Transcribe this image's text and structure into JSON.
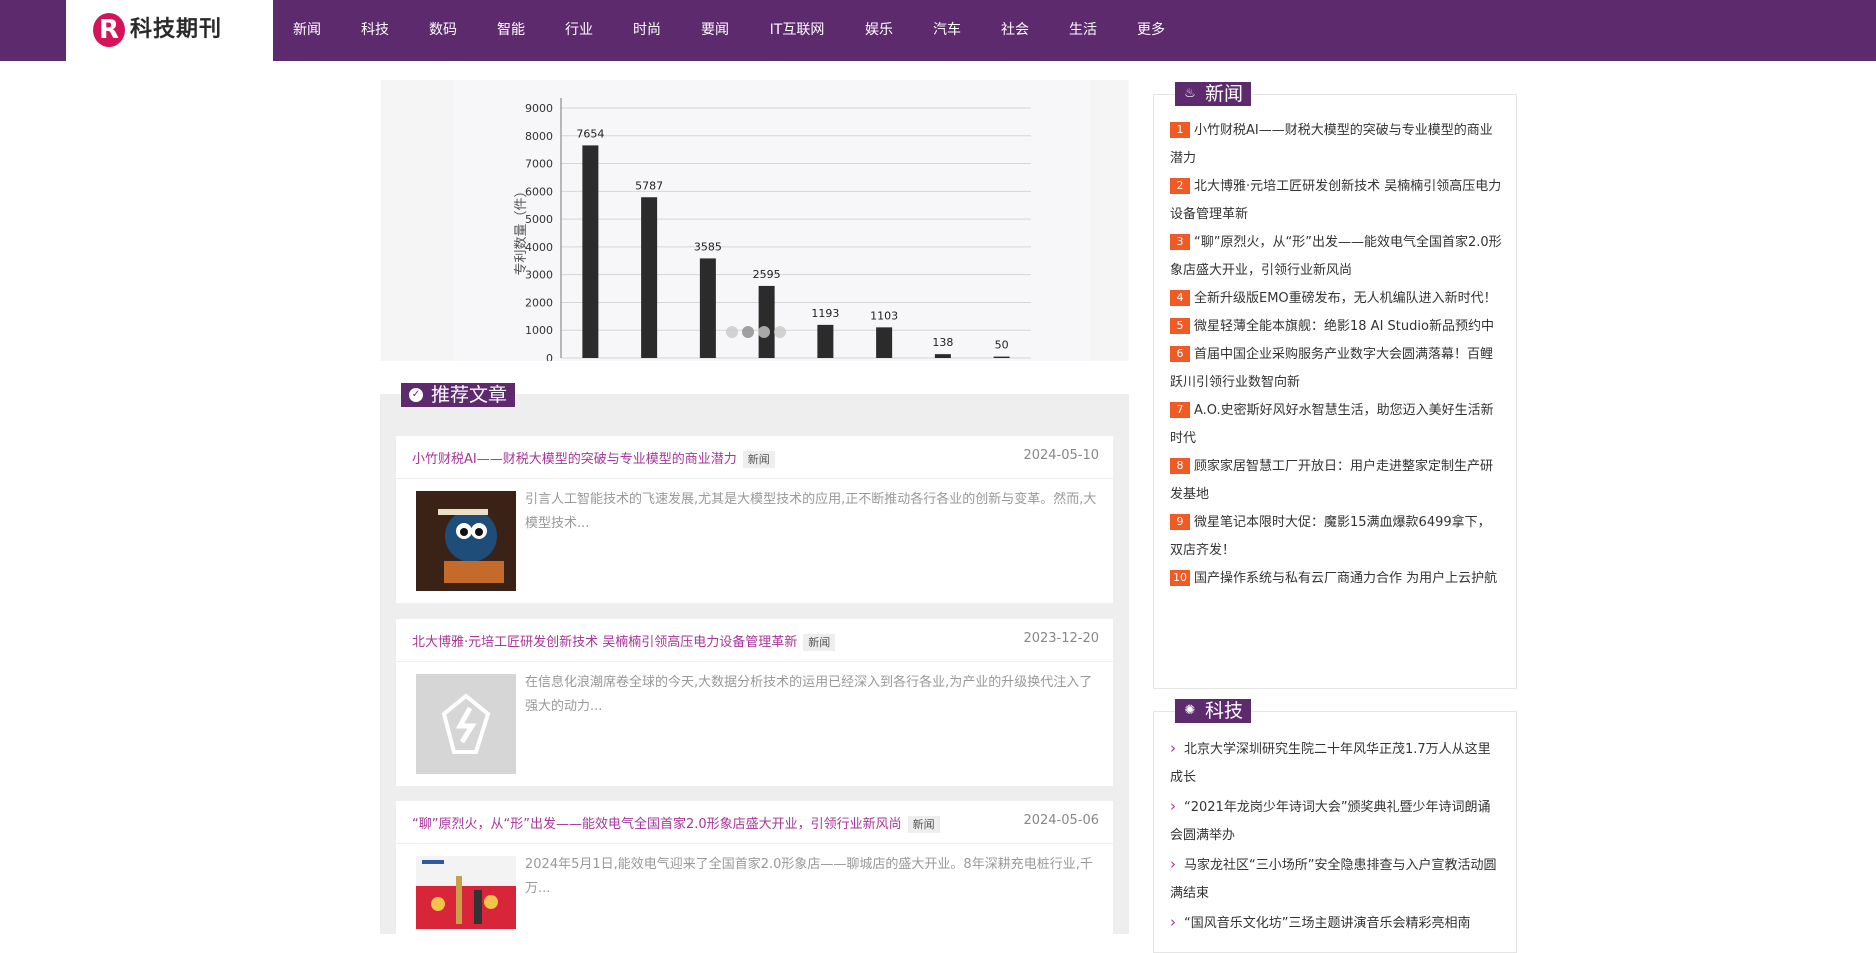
{
  "logo": {
    "text": "科技期刊",
    "mark": "R"
  },
  "nav": [
    "新闻",
    "科技",
    "数码",
    "智能",
    "行业",
    "时尚",
    "要闻",
    "IT互联网",
    "娱乐",
    "汽车",
    "社会",
    "生活",
    "更多"
  ],
  "slider": {
    "chart": {
      "ylabel": "专利数量（件）",
      "yticks": [
        "9000",
        "8000",
        "7000",
        "6000",
        "5000",
        "4000",
        "3000",
        "2000",
        "1000",
        "0"
      ],
      "values": [
        7654,
        5787,
        3585,
        2595,
        1193,
        1103,
        138,
        50
      ]
    },
    "dots": 4,
    "active_dot": 1
  },
  "recommended": {
    "title": "推荐文章",
    "articles": [
      {
        "title": "小竹财税AI——财税大模型的突破与专业模型的商业潜力",
        "badge": "新闻",
        "date": "2024-05-10",
        "summary": "引言人工智能技术的飞速发展,尤其是大模型技术的应用,正不断推动各行各业的创新与变革。然而,大模型技术..."
      },
      {
        "title": "北大博雅·元培工匠研发创新技术 吴楠楠引领高压电力设备管理革新",
        "badge": "新闻",
        "date": "2023-12-20",
        "summary": "在信息化浪潮席卷全球的今天,大数据分析技术的运用已经深入到各行各业,为产业的升级换代注入了强大的动力..."
      },
      {
        "title": "“聊”原烈火，从“形”出发——能效电气全国首家2.0形象店盛大开业，引领行业新风尚",
        "badge": "新闻",
        "date": "2024-05-06",
        "summary": "2024年5月1日,能效电气迎来了全国首家2.0形象店——聊城店的盛大开业。8年深耕充电桩行业,千万..."
      }
    ]
  },
  "sidebar_news": {
    "title": "新闻",
    "items": [
      "小竹财税AI——财税大模型的突破与专业模型的商业潜力",
      "北大博雅·元培工匠研发创新技术 吴楠楠引领高压电力设备管理革新",
      "“聊”原烈火，从“形”出发——能效电气全国首家2.0形象店盛大开业，引领行业新风尚",
      "全新升级版EMO重磅发布，无人机编队进入新时代！",
      "微星轻薄全能本旗舰：绝影18 AI Studio新品预约中",
      "首届中国企业采购服务产业数字大会圆满落幕！百鲤跃川引领行业数智向新",
      "A.O.史密斯好风好水智慧生活，助您迈入美好生活新时代",
      "顾家家居智慧工厂开放日：用户走进整家定制生产研发基地",
      "微星笔记本限时大促：魔影15满血爆款6499拿下，双店齐发！",
      "国产操作系统与私有云厂商通力合作 为用户上云护航"
    ]
  },
  "sidebar_tech": {
    "title": "科技",
    "items": [
      "北京大学深圳研究生院二十年风华正茂1.7万人从这里成长",
      "“2021年龙岗少年诗词大会”颁奖典礼暨少年诗词朗诵会圆满举办",
      "马家龙社区“三小场所”安全隐患排查与入户宣教活动圆满结束",
      "“国风音乐文化坊”三场主题讲演音乐会精彩亮相南"
    ]
  },
  "colors": {
    "brand": "#5d2a6e",
    "link": "#a7359b",
    "rank": "#f05a24"
  }
}
